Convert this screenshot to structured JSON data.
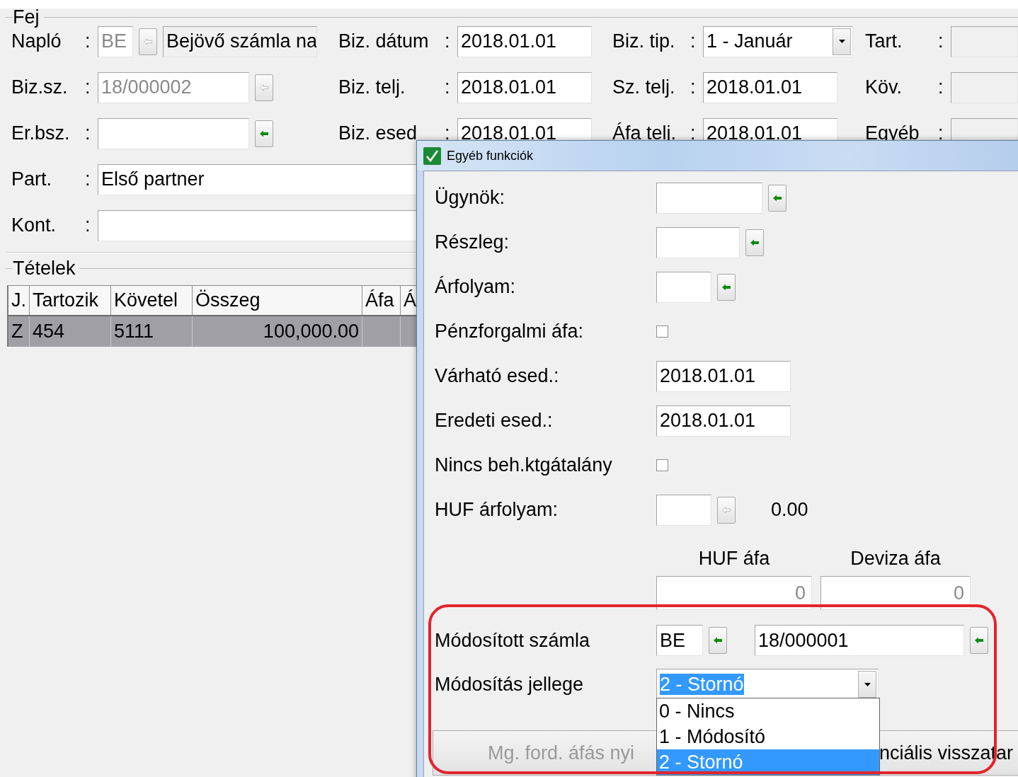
{
  "header": {
    "title": "Fej",
    "left": [
      {
        "kind": "journal",
        "label": "Napló",
        "sep": ":",
        "code": "BE",
        "name": "Bejövő számla na",
        "disabled": true
      },
      {
        "kind": "lookup",
        "label": "Biz.sz.",
        "sep": ":",
        "value": "18/000002",
        "disabled": true
      },
      {
        "kind": "lookup",
        "label": "Er.bsz.",
        "sep": ":",
        "disabled": false
      },
      {
        "kind": "text",
        "label": "Part.",
        "sep": ":",
        "value": "Első partner"
      },
      {
        "kind": "text",
        "label": "Kont.",
        "sep": ":"
      }
    ],
    "middle": [
      {
        "kind": "date",
        "label": "Biz. dátum",
        "sep": ":",
        "value": "2018.01.01"
      },
      {
        "kind": "date",
        "label": "Biz. telj.",
        "sep": ":",
        "value": "2018.01.01"
      },
      {
        "kind": "date",
        "label": "Biz. esed",
        "sep": ":",
        "value": "2018.01.01"
      }
    ],
    "right": [
      {
        "kind": "select",
        "label": "Biz. tip.",
        "sep": ":",
        "value": "1 - Január"
      },
      {
        "kind": "date",
        "label": "Sz. telj.",
        "sep": ":",
        "value": "2018.01.01"
      },
      {
        "kind": "date",
        "label": "Áfa telj.",
        "sep": ":",
        "value": "2018.01.01"
      }
    ],
    "far": [
      {
        "kind": "readonly",
        "label": "Tart.",
        "sep": ":"
      },
      {
        "kind": "readonly",
        "label": "Köv.",
        "sep": ":"
      },
      {
        "kind": "readonly",
        "label": "Egyéb",
        "sep": ":"
      }
    ]
  },
  "items": {
    "title": "Tételek",
    "columns": [
      "J.",
      "Tartozik",
      "Követel",
      "Összeg",
      "Áfa",
      "Á"
    ],
    "rows": [
      {
        "cells": [
          "Z",
          "454",
          "5111",
          "100,000.00",
          "",
          ""
        ],
        "selected": true
      }
    ]
  },
  "dialog": {
    "title": "Egyéb funkciók",
    "rows": [
      {
        "kind": "lookup",
        "label": "Ügynök:"
      },
      {
        "kind": "lookup",
        "label": "Részleg:"
      },
      {
        "kind": "lookup",
        "label": "Árfolyam:"
      },
      {
        "kind": "checkbox",
        "label": "Pénzforgalmi áfa:",
        "checked": false
      },
      {
        "kind": "date",
        "label": "Várható esed.:",
        "value": "2018.01.01"
      },
      {
        "kind": "date",
        "label": "Eredeti esed.:",
        "value": "2018.01.01"
      },
      {
        "kind": "checkbox",
        "label": "Nincs beh.ktgátalány",
        "checked": false
      },
      {
        "kind": "rate",
        "label": "HUF árfolyam:",
        "disabled": true,
        "reading": "0.00"
      },
      {
        "kind": "vat",
        "columns": [
          {
            "heading": "HUF áfa",
            "value": "0"
          },
          {
            "heading": "Deviza áfa",
            "value": "0"
          }
        ]
      },
      {
        "kind": "invoice_ref",
        "label": "Módosított számla",
        "journal": "BE",
        "number": "18/000001"
      },
      {
        "kind": "select",
        "label": "Módosítás jellege",
        "value": "2 - Stornó",
        "options": [
          {
            "label": "0 - Nincs",
            "selected": false
          },
          {
            "label": "1 - Módosító",
            "selected": false
          },
          {
            "label": "2 - Stornó",
            "selected": true
          }
        ]
      }
    ],
    "buttons": [
      {
        "label": "Mg. ford. áfás nyi",
        "disabled": true
      },
      {
        "label": "nciális visszatar",
        "disabled": false
      }
    ]
  }
}
